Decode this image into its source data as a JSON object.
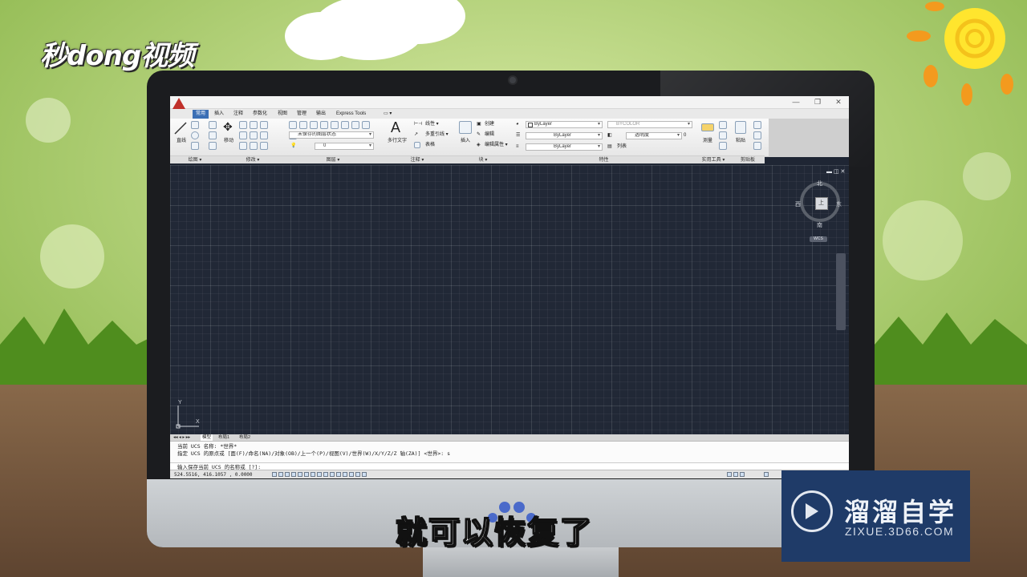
{
  "watermark": {
    "text": "秒dong视频"
  },
  "window": {
    "controls": [
      "—",
      "❐",
      "✕"
    ]
  },
  "ribbon_tabs": [
    "常用",
    "插入",
    "注释",
    "参数化",
    "视图",
    "管理",
    "输出",
    "Express Tools",
    "▭ ▾"
  ],
  "active_tab": "常用",
  "ribbon": {
    "draw": {
      "line_label": "直线",
      "group_label": "绘图 ▾"
    },
    "modify": {
      "move_label": "移动",
      "group_label": "修改 ▾"
    },
    "layers": {
      "layer_state": "未保存的图层状态",
      "layer_name": "0",
      "group_label": "图层 ▾"
    },
    "annotation": {
      "mtext_label": "多行文字",
      "linear_label": "线性 ▾",
      "multileader_label": "多重引线 ▾",
      "table_label": "表格",
      "group_label": "注释 ▾"
    },
    "block": {
      "insert_label": "插入",
      "create_label": "创建",
      "edit_label": "编辑",
      "edit_attr_label": "编辑属性 ▾",
      "group_label": "块 ▾"
    },
    "properties": {
      "color": "ByLayer",
      "linetype": "ByLayer",
      "lineweight": "ByLayer",
      "plot_style": "BYCOLOR",
      "transparency_label": "透明度",
      "transparency_value": "0",
      "list_label": "列表",
      "group_label": "特性"
    },
    "utilities": {
      "measure_label": "测量",
      "group_label": "实用工具 ▾"
    },
    "clipboard": {
      "paste_label": "粘贴",
      "group_label": "剪贴板"
    }
  },
  "viewcube": {
    "north": "北",
    "south": "南",
    "west": "西",
    "east": "东",
    "center": "上",
    "wcs": "WCS"
  },
  "ucs": {
    "y": "Y",
    "x": "X"
  },
  "layout_tabs": [
    "模型",
    "布局1",
    "布局2"
  ],
  "command": {
    "line1": "当前 UCS 名称: *世界*",
    "line2": "指定 UCS 的原点或 [面(F)/命名(NA)/对象(OB)/上一个(P)/视图(V)/世界(W)/X/Y/Z/Z 轴(ZA)] <世界>: s",
    "input": "输入保存当前 UCS 的名称或 [?]:"
  },
  "status": {
    "coords": "524.5516,  416.1057 , 0.0000"
  },
  "subtitle": "就可以恢复了",
  "brand": {
    "name": "溜溜自学",
    "url": "ZIXUE.3D66.COM"
  },
  "colors": {
    "accent": "#3b6fb5",
    "canvas": "#212836",
    "brand_bg": "#1f3b68"
  }
}
